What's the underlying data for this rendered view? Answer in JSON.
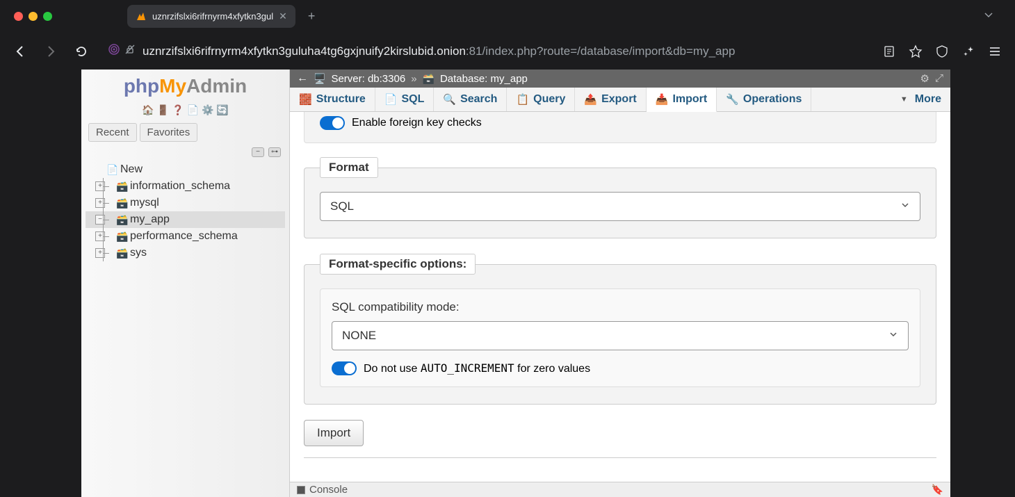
{
  "browser": {
    "tab_title": "uznrzifslxi6rifrnyrm4xfytkn3gul",
    "url_host": "uznrzifslxi6rifrnyrm4xfytkn3guluha4tg6gxjnuify2kirslubid.onion",
    "url_port_path": ":81/index.php?route=/database/import&db=my_app"
  },
  "logo": {
    "php": "php",
    "my": "My",
    "admin": "Admin"
  },
  "sidebar": {
    "recent_label": "Recent",
    "favorites_label": "Favorites",
    "tree": {
      "new_label": "New",
      "items": [
        {
          "name": "information_schema"
        },
        {
          "name": "mysql"
        },
        {
          "name": "my_app"
        },
        {
          "name": "performance_schema"
        },
        {
          "name": "sys"
        }
      ]
    }
  },
  "breadcrumb": {
    "server_label": "Server: db:3306",
    "database_label": "Database: my_app"
  },
  "tabs": {
    "structure": "Structure",
    "sql": "SQL",
    "search": "Search",
    "query": "Query",
    "export": "Export",
    "import": "Import",
    "operations": "Operations",
    "more": "More"
  },
  "toggles": {
    "foreign_key": "Enable foreign key checks",
    "auto_increment_prefix": "Do not use ",
    "auto_increment_code": "AUTO_INCREMENT",
    "auto_increment_suffix": " for zero values"
  },
  "format": {
    "legend": "Format",
    "value": "SQL"
  },
  "format_options": {
    "legend": "Format-specific options:",
    "compat_label": "SQL compatibility mode:",
    "compat_value": "NONE"
  },
  "import_button": "Import",
  "console_label": "Console"
}
